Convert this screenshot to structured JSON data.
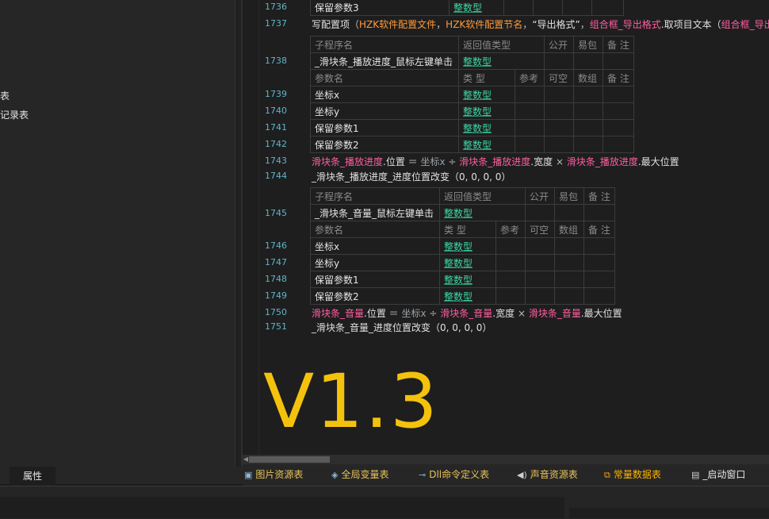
{
  "left_panel": {
    "items": [
      "表",
      "记录表"
    ]
  },
  "editor": {
    "lines": {
      "l1736": {
        "num": "1736"
      },
      "l1737": {
        "num": "1737",
        "cmd": "写配置项",
        "p1": "（",
        "a1": "HZK软件配置文件",
        "sep1": "，",
        "a2": "HZK软件配置节名",
        "sep2": "，",
        "a3": "“导出格式”",
        "sep3": "，",
        "a4": "组合框_导出格式",
        "a4b": ".取项目文本（",
        "a5": "组合框_导出"
      },
      "l1738": {
        "num": "1738"
      },
      "l1739": {
        "num": "1739"
      },
      "l1740": {
        "num": "1740"
      },
      "l1741": {
        "num": "1741"
      },
      "l1742": {
        "num": "1742"
      },
      "l1743": {
        "num": "1743",
        "obj": "滑块条_播放进度",
        "prop": ".位置",
        "eq": " ＝ ",
        "v1": "坐标x",
        "div": " ÷ ",
        "obj2": "滑块条_播放进度",
        "prop2": ".宽度",
        "mul": " × ",
        "obj3": "滑块条_播放进度",
        "prop3": ".最大位置"
      },
      "l1744": {
        "num": "1744",
        "text": "_滑块条_播放进度_进度位置改变（0, 0, 0, 0）"
      },
      "l1745": {
        "num": "1745"
      },
      "l1746": {
        "num": "1746"
      },
      "l1747": {
        "num": "1747"
      },
      "l1748": {
        "num": "1748"
      },
      "l1749": {
        "num": "1749"
      },
      "l1750": {
        "num": "1750",
        "obj": "滑块条_音量",
        "prop": ".位置",
        "eq": " ＝ ",
        "v1": "坐标x",
        "div": " ÷ ",
        "obj2": "滑块条_音量",
        "prop2": ".宽度",
        "mul": " × ",
        "obj3": "滑块条_音量",
        "prop3": ".最大位置"
      },
      "l1751": {
        "num": "1751",
        "text": "_滑块条_音量_进度位置改变（0, 0, 0, 0）"
      }
    },
    "top_row": {
      "name": "保留参数3",
      "type": "整数型"
    },
    "table1": {
      "headers": {
        "name": "子程序名",
        "ret": "返回值类型",
        "pub": "公开",
        "easy": "易包",
        "note": "备 注"
      },
      "sub_name": "_滑块条_播放进度_鼠标左键单击",
      "sub_ret": "整数型",
      "param_headers": {
        "name": "参数名",
        "type": "类 型",
        "ref": "参考",
        "nullable": "可空",
        "arr": "数组",
        "note": "备 注"
      },
      "params": [
        {
          "name": "坐标x",
          "type": "整数型"
        },
        {
          "name": "坐标y",
          "type": "整数型"
        },
        {
          "name": "保留参数1",
          "type": "整数型"
        },
        {
          "name": "保留参数2",
          "type": "整数型"
        }
      ]
    },
    "table2": {
      "headers": {
        "name": "子程序名",
        "ret": "返回值类型",
        "pub": "公开",
        "easy": "易包",
        "note": "备 注"
      },
      "sub_name": "_滑块条_音量_鼠标左键单击",
      "sub_ret": "整数型",
      "param_headers": {
        "name": "参数名",
        "type": "类 型",
        "ref": "参考",
        "nullable": "可空",
        "arr": "数组",
        "note": "备 注"
      },
      "params": [
        {
          "name": "坐标x",
          "type": "整数型"
        },
        {
          "name": "坐标y",
          "type": "整数型"
        },
        {
          "name": "保留参数1",
          "type": "整数型"
        },
        {
          "name": "保留参数2",
          "type": "整数型"
        }
      ]
    },
    "version_label": "V1.3"
  },
  "bottom_tabs": {
    "properties": "属性",
    "tabs": [
      {
        "label": "图片资源表",
        "icon": "image-icon",
        "color": "#e8c35a"
      },
      {
        "label": "全局变量表",
        "icon": "globe-variable-icon",
        "color": "#e8c35a"
      },
      {
        "label": "Dll命令定义表",
        "icon": "dll-link-icon",
        "color": "#e8c35a"
      },
      {
        "label": "声音资源表",
        "icon": "speaker-icon",
        "color": "#e8c35a"
      },
      {
        "label": "常量数据表",
        "icon": "constant-icon",
        "color": "#ffb400"
      },
      {
        "label": "_启动窗口",
        "icon": "window-icon",
        "color": "#e6e6e6"
      }
    ]
  },
  "colors": {
    "accent_yellow": "#f4c20d",
    "type_green": "#3dd6a6",
    "object_pink": "#ff5ea0",
    "line_number_cyan": "#5fb4c9"
  }
}
